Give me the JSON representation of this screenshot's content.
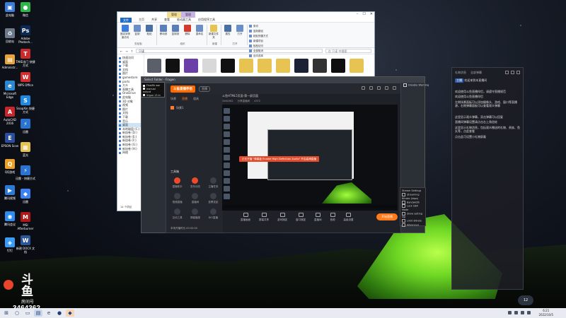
{
  "desktop": {
    "icons_left": [
      {
        "label": "此电脑",
        "color": "#3b7dd8",
        "glyph": "▣"
      },
      {
        "label": "回收站",
        "color": "#6c7a8c",
        "glyph": "♻"
      },
      {
        "label": "Administr...",
        "color": "#e8a33a",
        "glyph": "▤"
      },
      {
        "label": "Microsoft Edge",
        "color": "#2a87d0",
        "glyph": "e"
      },
      {
        "label": "AutoCAD 2016",
        "color": "#c8262b",
        "glyph": "A"
      },
      {
        "label": "EPSON Scan",
        "color": "#2a4e9c",
        "glyph": "E"
      },
      {
        "label": "QQ游戏",
        "color": "#f0a020",
        "glyph": "Q"
      },
      {
        "label": "腾讯视频",
        "color": "#2a7ad6",
        "glyph": "▶"
      },
      {
        "label": "腾讯会议",
        "color": "#2d8cf0",
        "glyph": "◉"
      },
      {
        "label": "钉钉",
        "color": "#3a9cf5",
        "glyph": "◈"
      }
    ],
    "icons_col2": [
      {
        "label": "微信",
        "color": "#2fb84a",
        "glyph": "●"
      },
      {
        "label": "Adobe Photosh...",
        "color": "#0c2a55",
        "glyph": "Ps"
      },
      {
        "label": "TAKE出门 快捷方式",
        "color": "#cc2a2a",
        "glyph": "T"
      },
      {
        "label": "WPS Office",
        "color": "#d42d2d",
        "glyph": "W"
      },
      {
        "label": "SnapXin 快捷方式",
        "color": "#1e88e5",
        "glyph": "S"
      },
      {
        "label": "迅雷",
        "color": "#2a73d1",
        "glyph": "⚡"
      },
      {
        "label": "蓝光",
        "color": "#e7c451",
        "glyph": "▦"
      },
      {
        "label": "迅雷 - 快捷方式",
        "color": "#2a73d1",
        "glyph": "⚡"
      },
      {
        "label": "迅雷",
        "color": "#3b82f6",
        "glyph": "◆"
      },
      {
        "label": "MSI Afterburner",
        "color": "#b01818",
        "glyph": "M"
      },
      {
        "label": "新建 DOCX 文档",
        "color": "#2b579a",
        "glyph": "W"
      }
    ]
  },
  "watermark": {
    "logo": "斗鱼",
    "sub": "房间号",
    "room": "3464362"
  },
  "explorer": {
    "ctx_tab_1": "管理",
    "ctx_tab_2": "管理",
    "tool_label_1": "驱动器工具",
    "tool_label_2": "应用程序工具",
    "menu": [
      "文件",
      "主页",
      "共享",
      "查看",
      "驱动器工具",
      "应用程序工具"
    ],
    "ribbon_items": [
      "固定到快速访问",
      "复制",
      "粘贴",
      "移动到",
      "复制到",
      "删除",
      "重命名",
      "新建文件夹",
      "属性",
      "打开",
      "全部选择"
    ],
    "ribbon_small": [
      "剪切",
      "复制路径",
      "粘贴快捷方式",
      "新建项目",
      "轻松访问",
      "全部取消",
      "反向选择"
    ],
    "group_labels": [
      "剪贴板",
      "组织",
      "新建",
      "打开",
      "选择"
    ],
    "address": "只读",
    "search_placeholder": "在 只读 中搜索",
    "nav": [
      "快速访问",
      "桌面",
      "下载",
      "文档",
      "图片",
      "gamestore",
      "parts",
      "大众",
      "直播工具",
      "OneDrive",
      "此电脑",
      "3D 对象",
      "视频",
      "图片",
      "文档",
      "下载",
      "音乐",
      "桌面",
      "本地磁盘 (C:)",
      "新加卷 (D:)",
      "新加卷 (E:)",
      "新加卷 (F:)",
      "新加卷 (G:)",
      "新加卷 (H:)",
      "网络"
    ],
    "status": "14 个项目",
    "thumb_colors": [
      "#5a5f6a",
      "#111111",
      "#6b3fa8",
      "#d8d8d8",
      "#111111",
      "#e7c451",
      "#e7c451",
      "#e7c451",
      "#1b2233",
      "#333333",
      "#0f0f0f",
      "#e7c451"
    ]
  },
  "outer_window": {
    "title": "Select Folder - Fragen"
  },
  "tiny_dialog": {
    "items": [
      "FinalSh ww",
      "manual output",
      "Vrgun 13 in"
    ]
  },
  "app": {
    "logo": "斗鱼直播伴侣",
    "tag": "直播",
    "left_tabs": [
      "场景",
      "直播",
      "道具"
    ],
    "scene_label": "场景1",
    "tools_title": "工具箱",
    "tools": [
      "直播助手",
      "发布动态",
      "主播任务",
      "视频直播",
      "直播间",
      "投票发起",
      "互动工具",
      "弹幕播报",
      "DIO直播"
    ],
    "bottom_note": "本场开播时长-00:00:00",
    "preview_title": "斗鱼HTML5页面-第一屏页面",
    "preview_sub": [
      "3464362",
      "分享直播间",
      "4372"
    ],
    "banner": "正在开播 \"弹幕板 Enable High Definition Audio\" 开启高清直播",
    "controls": [
      "直播画面",
      "屏幕共享",
      "游戏捕捉",
      "窗口捕捉",
      "直播间",
      "音频",
      "高级设置"
    ],
    "start_label": "开始直播"
  },
  "chat": {
    "tabs": [
      "礼物消息",
      "全部弹幕"
    ],
    "lines": [
      {
        "user": "主播",
        "text": "欢迎来到本直播间"
      },
      {
        "user": "",
        "text": "欢迎使用斗鱼直播伴侣，请遵守直播规范"
      },
      {
        "user": "",
        "text": "欢迎使用斗鱼直播伴侣"
      },
      {
        "user": "",
        "text": "左侧场景面板可以添加摄像头、游戏、窗口等直播源，右侧弹幕面板可以查看观众弹幕"
      },
      {
        "user": "",
        "text": "这里显示观众弹幕，双击弹幕可以回复"
      },
      {
        "user": "",
        "text": "直播间弹幕设置请点击右上角齿轮"
      },
      {
        "user": "",
        "text": "这里显示礼物消息，包括观众赠送的礼物、贵族、鱼丸等，点此查看"
      },
      {
        "user": "",
        "text": "点击此可设置小礼物屏蔽"
      }
    ],
    "right_tag": "Disable Warning"
  },
  "popup": {
    "title": "Stream Settings",
    "items": [
      "Streaming Bitrate (kbps)",
      "Bandwidth",
      "Lock CBR Mode",
      "Show setting log",
      "Limit Bitrate",
      "Advanced"
    ]
  },
  "taskbar": {
    "time": "6:21",
    "date": "2022/10/5",
    "notif_count": "12"
  }
}
